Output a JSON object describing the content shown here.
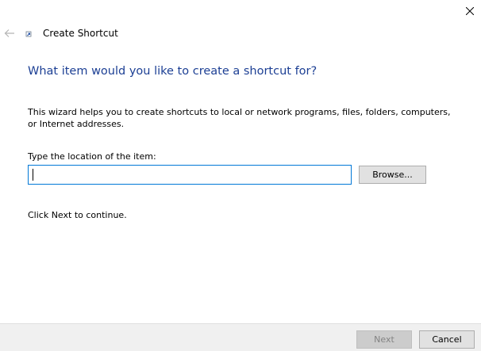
{
  "window": {
    "title": "Create Shortcut",
    "close_icon": "close-icon",
    "back_icon": "back-arrow-icon",
    "wizard_icon": "shortcut-icon"
  },
  "main": {
    "heading": "What item would you like to create a shortcut for?",
    "description": "This wizard helps you to create shortcuts to local or network programs, files, folders, computers, or Internet addresses.",
    "location_label": "Type the location of the item:",
    "location_value": "",
    "browse_label": "Browse...",
    "continue_text": "Click Next to continue."
  },
  "footer": {
    "next_label": "Next",
    "next_enabled": false,
    "cancel_label": "Cancel"
  },
  "colors": {
    "heading": "#1c3f94",
    "input_focus_border": "#0078d7",
    "footer_bg": "#f0f0f0",
    "button_bg": "#e1e1e1",
    "disabled_button_bg": "#cccccc",
    "disabled_text": "#838383"
  }
}
